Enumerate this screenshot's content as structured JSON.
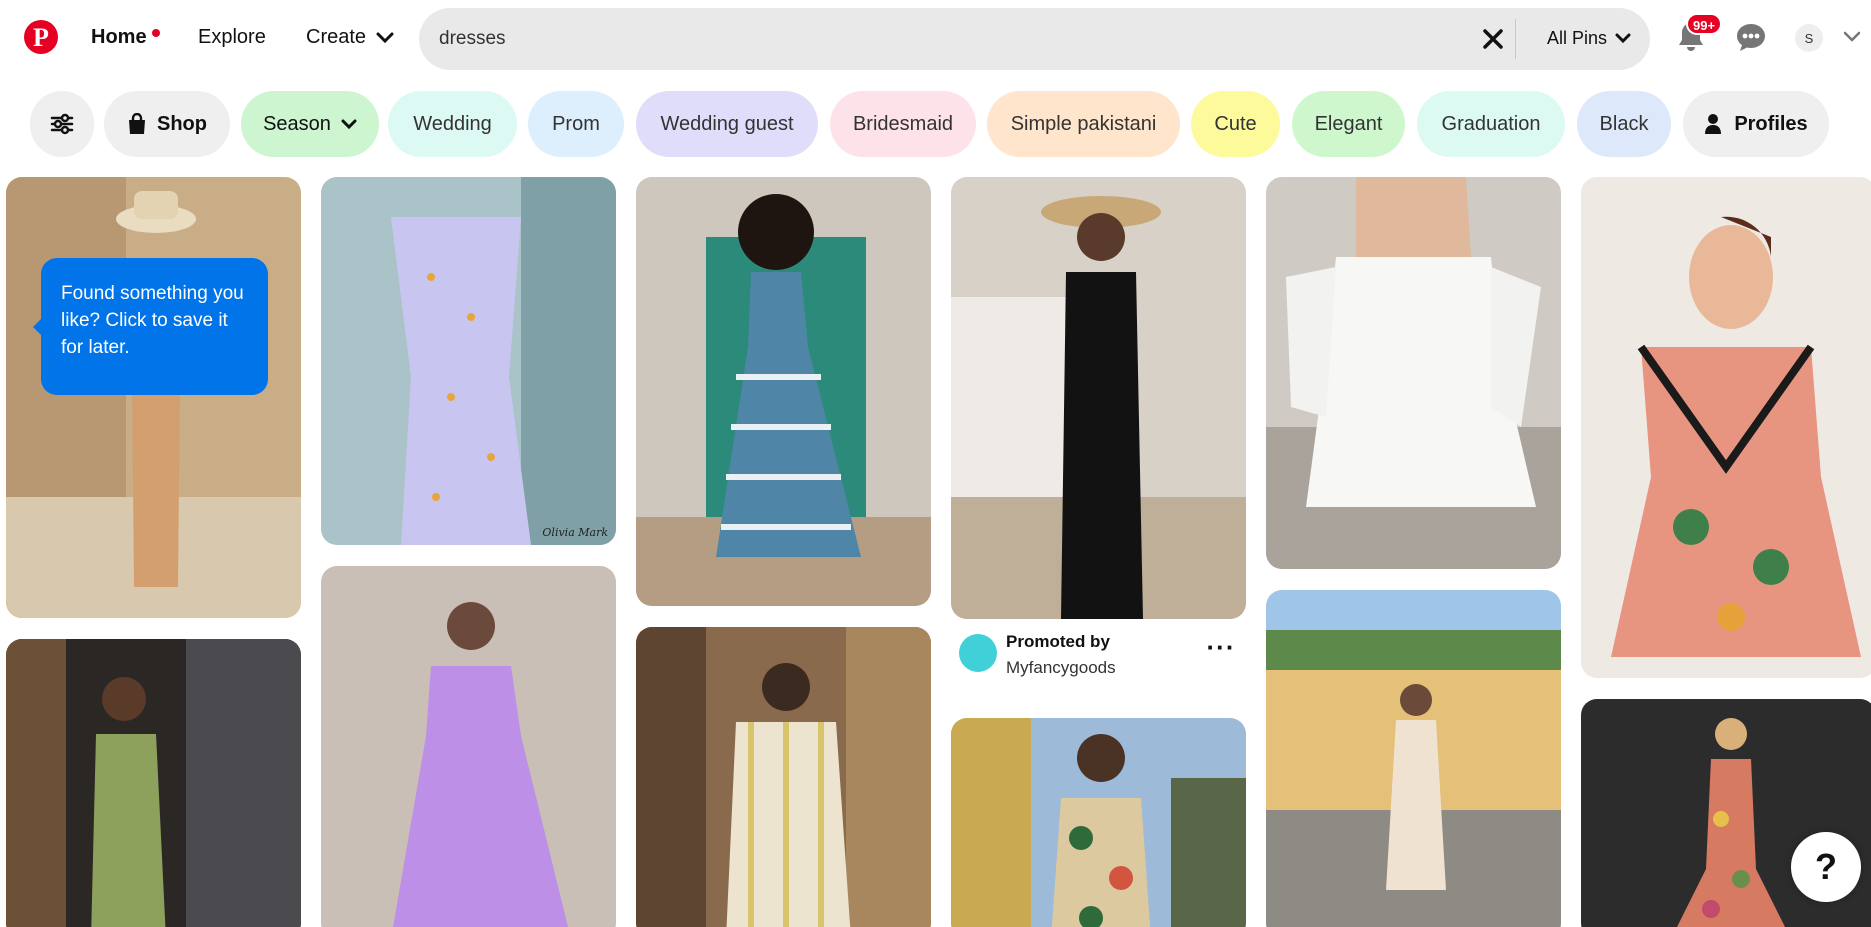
{
  "header": {
    "logo_icon": "pinterest-logo-icon",
    "logo_letter": "P",
    "nav": {
      "home": "Home",
      "explore": "Explore",
      "create": "Create"
    },
    "search": {
      "value": "dresses",
      "scope": "All Pins"
    },
    "notifications_badge": "99+",
    "avatar_initial": "S"
  },
  "chips": [
    {
      "label": "Shop",
      "icon": "shopping-bag-icon"
    },
    {
      "label": "Season",
      "icon": "chevron-down-icon"
    },
    {
      "label": "Wedding",
      "color": "#ddf9f4"
    },
    {
      "label": "Prom",
      "color": "#ddeefc"
    },
    {
      "label": "Wedding guest",
      "color": "#e0ddfb"
    },
    {
      "label": "Bridesmaid",
      "color": "#fde2ea"
    },
    {
      "label": "Simple pakistani",
      "color": "#fee5cc"
    },
    {
      "label": "Cute",
      "color": "#fdfa9c"
    },
    {
      "label": "Elegant",
      "color": "#cff7cd"
    },
    {
      "label": "Graduation",
      "color": "#ddfaf2"
    },
    {
      "label": "Black",
      "color": "#dde9fb"
    },
    {
      "label": "Profiles",
      "icon": "person-icon"
    }
  ],
  "tooltip": {
    "text": "Found something you like? Click to save it for later."
  },
  "promoted_pin": {
    "label": "Promoted by",
    "advertiser": "Myfancygoods"
  },
  "pin_watermark": "Olivia Mark",
  "help_button": "?",
  "colors": {
    "brand": "#e60023",
    "tooltip": "#0074e8",
    "search_bg": "#e9e9e9"
  }
}
